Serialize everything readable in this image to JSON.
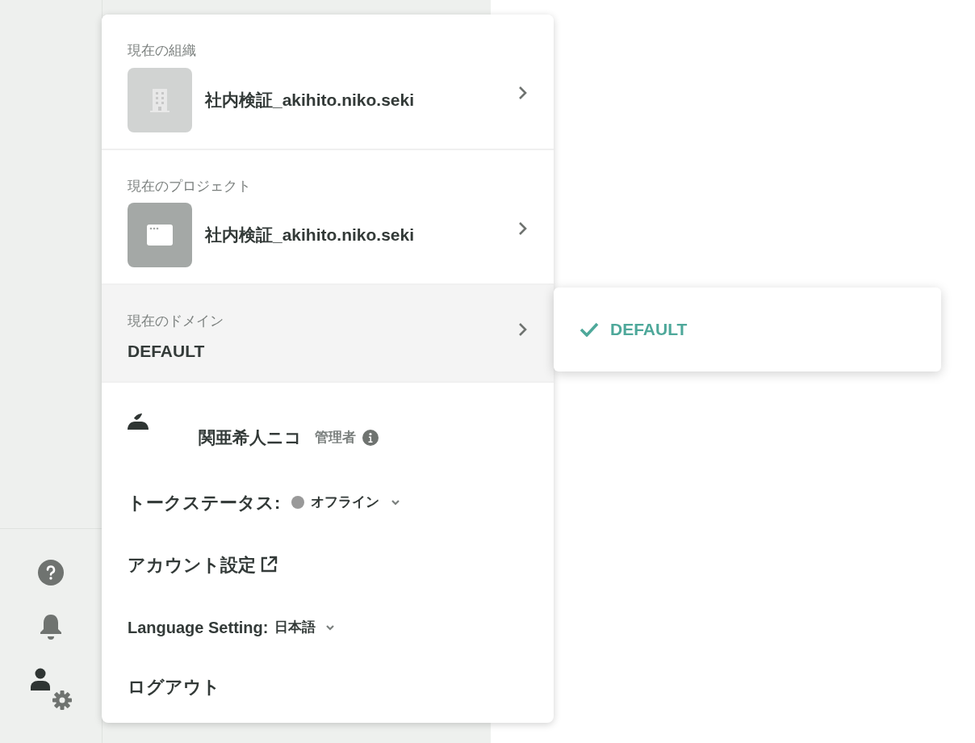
{
  "organization": {
    "label": "現在の組織",
    "name": "社内検証_akihito.niko.seki"
  },
  "project": {
    "label": "現在のプロジェクト",
    "name": "社内検証_akihito.niko.seki"
  },
  "domain": {
    "label": "現在のドメイン",
    "value": "DEFAULT",
    "selected": true
  },
  "domain_submenu": {
    "items": [
      {
        "label": "DEFAULT",
        "checked": true
      }
    ]
  },
  "user": {
    "name": "関亜希人ニコ",
    "role": "管理者"
  },
  "talk_status": {
    "label": "トークステータス:",
    "value": "オフライン"
  },
  "account_settings": {
    "label": "アカウント設定"
  },
  "language": {
    "label": "Language Setting:",
    "value": "日本語"
  },
  "logout": {
    "label": "ログアウト"
  }
}
